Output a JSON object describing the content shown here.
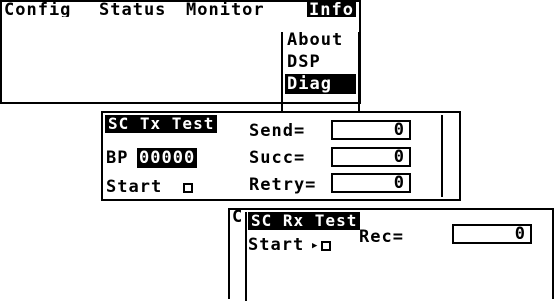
{
  "menu": {
    "items": [
      "Config",
      "Status",
      "Monitor",
      "Info"
    ],
    "active_index": 3
  },
  "info_dropdown": {
    "items": [
      "About",
      "DSP",
      "Diag"
    ],
    "selected_index": 2
  },
  "tx_test": {
    "title": "SC Tx Test",
    "bp_label": "BP",
    "bp_value": "00000",
    "start_label": "Start",
    "send_label": "Send=",
    "send_value": "0",
    "succ_label": "Succ=",
    "succ_value": "0",
    "retry_label": "Retry=",
    "retry_value": "0"
  },
  "rx_test": {
    "partial_label": "C",
    "title": "SC Rx Test",
    "start_label": "Start",
    "rec_label": "Rec=",
    "rec_value": "0"
  },
  "colors": {
    "foreground": "#000000",
    "background": "#ffffff"
  }
}
